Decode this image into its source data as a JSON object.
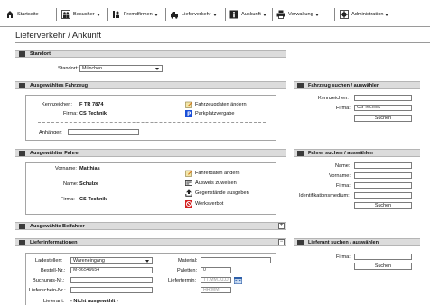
{
  "nav": {
    "items": [
      {
        "label": "Startseite",
        "icon": "home-icon"
      },
      {
        "label": "Besucher",
        "icon": "visitors-icon"
      },
      {
        "label": "Fremdfirmen",
        "icon": "contractor-icon"
      },
      {
        "label": "Lieferverkehr",
        "icon": "truck-icon"
      },
      {
        "label": "Auskunft",
        "icon": "info-icon"
      },
      {
        "label": "Verwaltung",
        "icon": "printer-icon"
      },
      {
        "label": "Administration",
        "icon": "gear-icon"
      }
    ]
  },
  "page": {
    "title": "Lieferverkehr / Ankunft"
  },
  "standort": {
    "header": "Standort",
    "label": "Standort:",
    "selected": "München"
  },
  "fahrzeug": {
    "header": "Ausgewähltes Fahrzeug",
    "kennzeichen_label": "Kennzeichen:",
    "kennzeichen_value": "F TR 7874",
    "firma_label": "Firma:",
    "firma_value": "CS Technik",
    "anhaenger_label": "Anhänger:",
    "anhaenger_value": "",
    "action_edit": "Fahrzeugdaten ändern",
    "action_parking": "Parkplatzvergabe"
  },
  "fahrzeug_search": {
    "header": "Fahrzeug suchen / auswählen",
    "kennzeichen_label": "Kennzeichen:",
    "kennzeichen_value": "",
    "firma_label": "Firma:",
    "firma_value": "CS Technik",
    "button": "Suchen"
  },
  "fahrer": {
    "header": "Ausgewählter Fahrer",
    "vorname_label": "Vorname:",
    "vorname_value": "Matthias",
    "name_label": "Name:",
    "name_value": "Schulze",
    "firma_label": "Firma:",
    "firma_value": "CS Technik",
    "action_edit": "Fahrerdaten ändern",
    "action_badge": "Ausweis zuweisen",
    "action_items": "Gegenstände ausgeben",
    "action_ban": "Werksverbot"
  },
  "fahrer_search": {
    "header": "Fahrer suchen / auswählen",
    "name_label": "Name:",
    "vorname_label": "Vorname:",
    "firma_label": "Firma:",
    "id_label": "Identifikationsmedium:",
    "button": "Suchen"
  },
  "beifahrer": {
    "header": "Ausgewählte Beifahrer",
    "toggle": "+"
  },
  "liefer": {
    "header": "Lieferinformationen",
    "toggle": "−",
    "ladestellen_label": "Ladestellen:",
    "ladestellen_value": "Wareneingang",
    "bestell_label": "Bestell-Nr.:",
    "bestell_value": "M-86549654",
    "buchungs_label": "Buchungs-Nr.:",
    "buchungs_value": "",
    "lieferschein_label": "Lieferschein-Nr.:",
    "lieferschein_value": "",
    "lieferant_label": "Lieferant:",
    "lieferant_value": "- Nicht ausgewählt -",
    "material_label": "Material:",
    "material_value": "",
    "paletten_label": "Paletten:",
    "paletten_value": "0",
    "termin_label": "Liefertermin:",
    "date_placeholder": "TT.MM.JJJJ",
    "time_placeholder": "HH:MM"
  },
  "lieferant_search": {
    "header": "Lieferant suchen / auswählen",
    "firma_label": "Firma:",
    "button": "Suchen"
  },
  "colors": {
    "header_bg": "#dcdcdc",
    "border": "#a5a5a5",
    "parking_blue": "#1a4fd8",
    "ban_red": "#d42020"
  }
}
